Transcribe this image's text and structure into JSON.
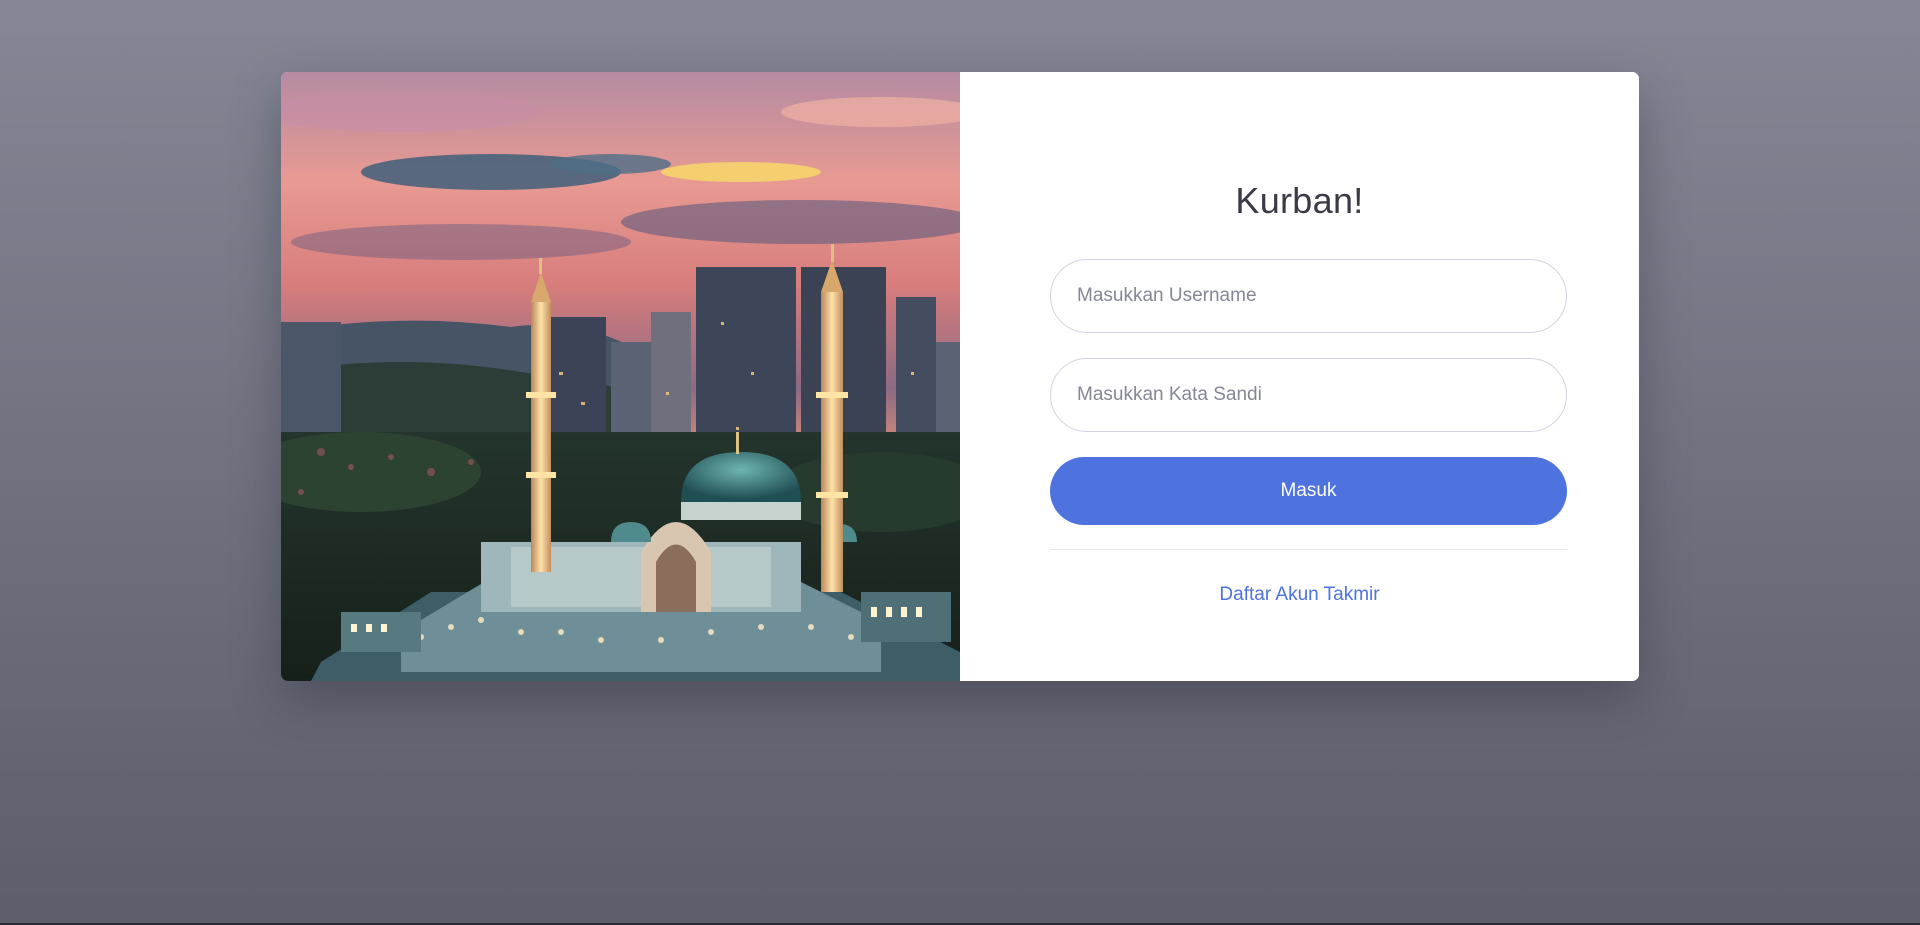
{
  "login": {
    "title": "Kurban!",
    "username_placeholder": "Masukkan Username",
    "password_placeholder": "Masukkan Kata Sandi",
    "submit_label": "Masuk",
    "register_link": "Daftar Akun Takmir"
  },
  "colors": {
    "primary": "#4e73df",
    "page_background": "#858796",
    "card_background": "#ffffff",
    "title_text": "#3a3b45"
  }
}
